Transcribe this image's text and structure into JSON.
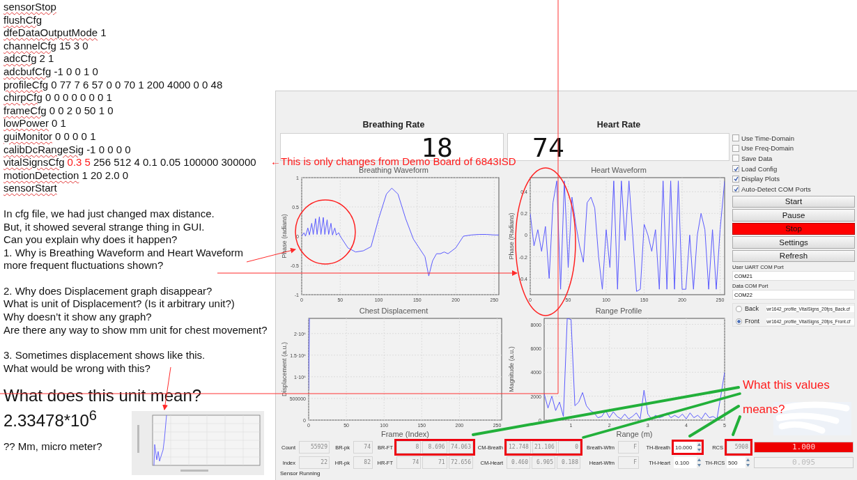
{
  "document": {
    "config_lines": [
      {
        "command": "sensorStop"
      },
      {
        "command": "flushCfg"
      },
      {
        "command": "dfeDataOutputMode",
        "args": "1"
      },
      {
        "command": "channelCfg",
        "args": "15 3 0"
      },
      {
        "command": "adcCfg",
        "args": "2 1"
      },
      {
        "command": "adcbufCfg",
        "args": "-1 0 0 1 0"
      },
      {
        "command": "profileCfg",
        "args": "0 77 7 6 57 0 0 70 1 200 4000 0 0 48"
      },
      {
        "command": "chirpCfg",
        "args": "0 0 0 0 0 0 0 1"
      },
      {
        "command": "frameCfg",
        "args": "0 0 2 0 50 1 0"
      },
      {
        "command": "lowPower",
        "args": "0 1"
      },
      {
        "command": "guiMonitor",
        "args": "0 0 0 0 1"
      },
      {
        "command": "calibDcRangeSig",
        "args": "-1 0 0 0 0"
      },
      {
        "command": "vitalSignsCfg",
        "changed_args": "0.3 5",
        "args": "256 512 4 0.1 0.05 100000 300000"
      },
      {
        "command": "motionDetection",
        "args": "1 20 2.0 0"
      },
      {
        "command": "sensorStart"
      }
    ],
    "paragraphs": [
      [
        "In cfg file, we had just changed max distance.",
        "But, it showed several strange thing in GUI.",
        "Can you explain why does it happen?",
        "1.  Why is Breathing Waveform and Heart Waveform",
        "more frequent fluctuations shown?"
      ],
      [
        "2. Why does Displacement graph disappear?",
        "What is unit of Displacement? (Is it arbitrary unit?)",
        "Why doesn’t it show any graph?",
        "Are there any way to show mm unit for chest movement?"
      ],
      [
        "3. Sometimes displacement shows like this.",
        "What would be wrong with this?"
      ]
    ],
    "question": "What does this unit mean?",
    "value": "2.33478*10$^{6}$",
    "guess": "?? Mm, micro meter?"
  },
  "callouts": [
    "←This is only changes from Demo Board of 6843ISD",
    "What this values",
    "means?"
  ],
  "panel": {
    "rates": [
      {
        "title": "Breathing Rate",
        "value": "18"
      },
      {
        "title": "Heart Rate",
        "value": "74"
      }
    ],
    "plots": [
      {
        "chart_data": {
          "type": "line",
          "title": "Breathing Waveform",
          "ylabel": "Phase (radians)",
          "xlim": [
            0,
            256
          ],
          "ylim": [
            -1,
            1
          ],
          "xticks": [
            0,
            50,
            100,
            150,
            200,
            250
          ],
          "yticks": [
            -1,
            -0.5,
            0,
            0.5,
            1
          ],
          "x": [
            0,
            3,
            5,
            8,
            10,
            13,
            15,
            18,
            20,
            23,
            25,
            28,
            30,
            33,
            35,
            38,
            40,
            43,
            45,
            48,
            50,
            60,
            70,
            80,
            90,
            100,
            110,
            117,
            125,
            135,
            145,
            155,
            160,
            165,
            170,
            175,
            180,
            185,
            190,
            200,
            210,
            220,
            230,
            240,
            250,
            256
          ],
          "grid": true,
          "series": [
            {
              "color": "#5a5aff",
              "values": [
                0,
                0.06,
                0,
                0.14,
                0.02,
                0.22,
                0.03,
                0.3,
                0.03,
                0.33,
                0.03,
                0.32,
                0.03,
                0.28,
                0.03,
                0.22,
                0.02,
                0.14,
                0.02,
                0.06,
                0,
                -0.2,
                -0.27,
                -0.25,
                -0.18,
                0.3,
                0.72,
                0.82,
                0.72,
                0.3,
                -0.05,
                -0.25,
                -0.35,
                -0.68,
                -0.42,
                -0.3,
                -0.3,
                -0.27,
                -0.3,
                -0.2,
                0.0,
                0.02,
                0.03,
                0.03,
                0.02,
                0.02
              ]
            }
          ]
        }
      },
      {
        "chart_data": {
          "type": "line",
          "title": "Heart Waveform",
          "ylabel": "Phase (Radians)",
          "xlim": [
            0,
            256
          ],
          "ylim": [
            -0.55,
            0.53
          ],
          "xticks": [
            0,
            50,
            100,
            150,
            200,
            250
          ],
          "yticks": [
            -0.4,
            -0.2,
            0,
            0.2,
            0.4
          ],
          "x": [
            0,
            5,
            10,
            15,
            20,
            25,
            30,
            35,
            40,
            45,
            50,
            55,
            60,
            65,
            70,
            75,
            80,
            85,
            90,
            95,
            100,
            105,
            110,
            115,
            120,
            125,
            130,
            135,
            140,
            145,
            150,
            155,
            160,
            165,
            170,
            175,
            180,
            185,
            190,
            195,
            200,
            205,
            210,
            215,
            220,
            225,
            230,
            235,
            240,
            245,
            250,
            256
          ],
          "grid": true,
          "series": [
            {
              "color": "#5a5aff",
              "values": [
                0.2,
                -0.1,
                0.05,
                -0.15,
                0.08,
                -0.4,
                0.3,
                0.5,
                -0.5,
                0.5,
                -0.3,
                0.35,
                0.1,
                -0.1,
                -0.25,
                0.3,
                0.35,
                0.25,
                -0.2,
                -0.5,
                0.05,
                -0.3,
                0.5,
                -0.5,
                0.5,
                -0.05,
                0.5,
                0.0,
                -0.52,
                -0.5,
                0.1,
                0.0,
                -0.15,
                0.05,
                -0.5,
                0.5,
                -0.5,
                0.5,
                -0.5,
                0.5,
                -0.5,
                -0.5,
                0.0,
                -0.5,
                0.0,
                0.2,
                0.05,
                -0.5,
                0.05,
                -0.5,
                0.05,
                0.5
              ]
            }
          ]
        }
      },
      {
        "chart_data": {
          "type": "line",
          "title": "Chest Displacement",
          "xlabel": "Frame (Index)",
          "ylabel": "Displacement (a.u.)",
          "xlim": [
            0,
            256
          ],
          "ylim": [
            0,
            2350000
          ],
          "xticks": [
            0,
            50,
            100,
            150,
            200,
            250
          ],
          "yticks": [
            0,
            500000,
            {
              "value": 1000000,
              "label": "1·10⁶"
            },
            {
              "value": 1500000,
              "label": "1.5·10⁶"
            },
            {
              "value": 2000000,
              "label": "2·10⁶"
            }
          ],
          "x": [
            0,
            1
          ],
          "grid": true,
          "series": [
            {
              "color": "#5a5aff",
              "values": [
                700000,
                2350000
              ]
            }
          ]
        }
      },
      {
        "chart_data": {
          "type": "line",
          "title": "Range Profile",
          "xlabel": "Range (m)",
          "ylabel": "Magnitude (a.u.)",
          "xlim": [
            0.3,
            5
          ],
          "ylim": [
            0,
            8500
          ],
          "xticks": [
            1,
            2,
            3,
            4,
            5
          ],
          "yticks": [
            0,
            2000,
            4000,
            6000,
            8000
          ],
          "x": [
            0.3,
            0.4,
            0.5,
            0.6,
            0.7,
            0.8,
            0.9,
            1.0,
            1.1,
            1.2,
            1.3,
            1.4,
            1.5,
            1.6,
            1.7,
            1.8,
            1.9,
            2.0,
            2.1,
            2.2,
            2.3,
            2.4,
            2.5,
            2.6,
            2.7,
            2.8,
            2.9,
            3.0,
            3.1,
            3.2,
            3.3,
            3.4,
            3.5,
            3.6,
            3.7,
            3.8,
            3.9,
            4.0,
            4.1,
            4.2,
            4.3,
            4.4,
            4.5,
            4.6,
            4.7,
            4.8,
            4.9,
            5.0
          ],
          "grid": true,
          "series": [
            {
              "color": "#5a5aff",
              "values": [
                2200,
                1000,
                2000,
                800,
                1500,
                300,
                8500,
                8400,
                1200,
                1500,
                2300,
                1200,
                800,
                600,
                200,
                300,
                800,
                200,
                700,
                300,
                100,
                500,
                100,
                300,
                600,
                100,
                2500,
                500,
                100,
                400,
                200,
                300,
                600,
                200,
                400,
                200,
                500,
                100,
                600,
                200,
                400,
                100,
                600,
                200,
                300,
                100,
                2000,
                4000
              ]
            }
          ]
        }
      }
    ],
    "options": [
      {
        "label": "Use Time-Domain",
        "checked": false
      },
      {
        "label": "Use Freq-Domain",
        "checked": false
      },
      {
        "label": "Save Data",
        "checked": false
      },
      {
        "label": "Load Config",
        "checked": true
      },
      {
        "label": "Display Plots",
        "checked": true
      },
      {
        "label": "Auto-Detect COM Ports",
        "checked": true
      }
    ],
    "buttons": [
      {
        "label": "Start",
        "active": false
      },
      {
        "label": "Pause",
        "active": false
      },
      {
        "label": "Stop",
        "active": true
      },
      {
        "label": "Settings",
        "active": false
      },
      {
        "label": "Refresh",
        "active": false
      }
    ],
    "ports": [
      {
        "label": "User UART COM Port",
        "value": "COM21"
      },
      {
        "label": "Data COM Port",
        "value": "COM22"
      }
    ],
    "profiles": [
      {
        "label": "Back",
        "file": "wr1642_profile_VitalSigns_20fps_Back.cf",
        "selected": false
      },
      {
        "label": "Front",
        "file": "wr1642_profile_VitalSigns_20fps_Front.cf",
        "selected": true
      }
    ],
    "readings": [
      {
        "cells": [
          {
            "kind": "label",
            "text": "Count"
          },
          {
            "kind": "readouts",
            "values": [
              "55929"
            ],
            "marked": false
          },
          {
            "kind": "label",
            "text": "BR-pk"
          },
          {
            "kind": "readouts",
            "values": [
              "74"
            ],
            "marked": false
          },
          {
            "kind": "label",
            "text": "BR-FT"
          },
          {
            "kind": "readouts",
            "values": [
              "8",
              "8.696",
              "74.063"
            ],
            "marked": true
          },
          {
            "kind": "label",
            "text": "CM-Breath"
          },
          {
            "kind": "readouts",
            "values": [
              "12.748",
              "21.106",
              "0"
            ],
            "marked": true
          },
          {
            "kind": "label",
            "text": "Breath-Wfm"
          },
          {
            "kind": "readouts",
            "values": [
              "F"
            ],
            "marked": false
          },
          {
            "kind": "label",
            "text": "TH-Breath"
          },
          {
            "kind": "spin",
            "value": "10.000",
            "marked": true
          },
          {
            "kind": "label",
            "text": "RCS"
          },
          {
            "kind": "readouts",
            "values": [
              "5908"
            ],
            "marked": true
          },
          {
            "kind": "bar",
            "text": "1.000",
            "alert": true
          }
        ]
      },
      {
        "cells": [
          {
            "kind": "label",
            "text": "Index"
          },
          {
            "kind": "readouts",
            "values": [
              "22"
            ],
            "marked": false
          },
          {
            "kind": "label",
            "text": "HR-pk"
          },
          {
            "kind": "readouts",
            "values": [
              "82"
            ],
            "marked": false
          },
          {
            "kind": "label",
            "text": "HR-FT"
          },
          {
            "kind": "readouts",
            "values": [
              "74",
              "71",
              "72.656"
            ],
            "marked": false
          },
          {
            "kind": "label",
            "text": "CM-Heart"
          },
          {
            "kind": "readouts",
            "values": [
              "0.460",
              "6.905",
              "0.188"
            ],
            "marked": false
          },
          {
            "kind": "label",
            "text": "Heart-Wfm"
          },
          {
            "kind": "readouts",
            "values": [
              "F"
            ],
            "marked": false
          },
          {
            "kind": "label",
            "text": "TH-Heart"
          },
          {
            "kind": "spin",
            "value": "0.100",
            "marked": false
          },
          {
            "kind": "label",
            "text": "TH-RCS"
          },
          {
            "kind": "spin",
            "value": "500",
            "marked": false
          },
          {
            "kind": "bar",
            "text": "0.095",
            "alert": false
          }
        ]
      }
    ],
    "status": "Sensor Running"
  }
}
